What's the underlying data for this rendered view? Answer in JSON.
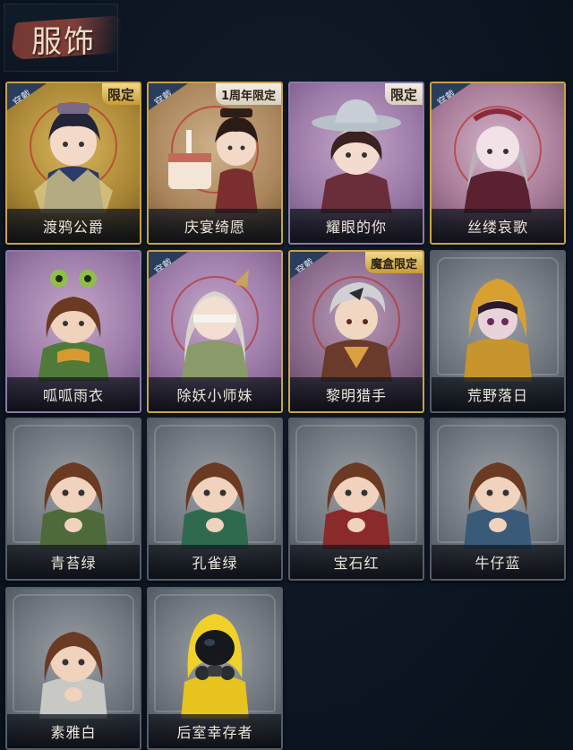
{
  "header": {
    "title": "服饰"
  },
  "cards": [
    {
      "name": "渡鸦公爵",
      "frame": "gold",
      "worn": true,
      "worn_label": "穿戴",
      "limit": "限定"
    },
    {
      "name": "庆宴绮愿",
      "frame": "gold",
      "worn": true,
      "worn_label": "穿戴",
      "limit": "1周年限定"
    },
    {
      "name": "耀眼的你",
      "frame": "purple",
      "worn": false,
      "limit": "限定"
    },
    {
      "name": "丝缕哀歌",
      "frame": "purple",
      "worn": true,
      "worn_label": "穿戴"
    },
    {
      "name": "呱呱雨衣",
      "frame": "purple",
      "worn": false
    },
    {
      "name": "除妖小师妹",
      "frame": "purple",
      "worn": true,
      "worn_label": "穿戴"
    },
    {
      "name": "黎明猎手",
      "frame": "purple",
      "worn": true,
      "worn_label": "穿戴",
      "limit": "魔盒限定"
    },
    {
      "name": "荒野落日",
      "frame": "gray",
      "worn": false
    },
    {
      "name": "青苔绿",
      "frame": "gray",
      "worn": false
    },
    {
      "name": "孔雀绿",
      "frame": "gray",
      "worn": false
    },
    {
      "name": "宝石红",
      "frame": "gray",
      "worn": false
    },
    {
      "name": "牛仔蓝",
      "frame": "gray",
      "worn": false
    },
    {
      "name": "素雅白",
      "frame": "gray",
      "worn": false
    },
    {
      "name": "后室幸存者",
      "frame": "gray",
      "worn": false
    }
  ],
  "colors": {
    "background": "#0c1522",
    "gold_frame": "#c9a347",
    "purple_frame": "#9c7aa8",
    "gray_frame": "#6f757d",
    "wear_badge": "#2a3d5c"
  }
}
